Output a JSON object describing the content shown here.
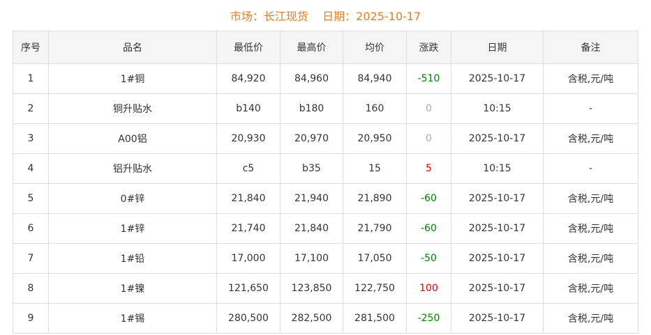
{
  "header": {
    "title": "市场：长江现货    日期：2025-10-17"
  },
  "colors": {
    "title": "#e67e22",
    "down": "#008000",
    "up": "#e00000",
    "flat": "#aaaaaa"
  },
  "table": {
    "columns": [
      "序号",
      "品名",
      "最低价",
      "最高价",
      "均价",
      "涨跌",
      "日期",
      "备注"
    ],
    "rows": [
      {
        "no": "1",
        "name": "1#铜",
        "low": "84,920",
        "high": "84,960",
        "avg": "84,940",
        "change": "-510",
        "change_dir": "down",
        "date": "2025-10-17",
        "note": "含税,元/吨"
      },
      {
        "no": "2",
        "name": "铜升贴水",
        "low": "b140",
        "high": "b180",
        "avg": "160",
        "change": "0",
        "change_dir": "flat",
        "date": "10:15",
        "note": "-"
      },
      {
        "no": "3",
        "name": "A00铝",
        "low": "20,930",
        "high": "20,970",
        "avg": "20,950",
        "change": "0",
        "change_dir": "flat",
        "date": "2025-10-17",
        "note": "含税,元/吨"
      },
      {
        "no": "4",
        "name": "铝升贴水",
        "low": "c5",
        "high": "b35",
        "avg": "15",
        "change": "5",
        "change_dir": "up",
        "date": "10:15",
        "note": "-"
      },
      {
        "no": "5",
        "name": "0#锌",
        "low": "21,840",
        "high": "21,940",
        "avg": "21,890",
        "change": "-60",
        "change_dir": "down",
        "date": "2025-10-17",
        "note": "含税,元/吨"
      },
      {
        "no": "6",
        "name": "1#锌",
        "low": "21,740",
        "high": "21,840",
        "avg": "21,790",
        "change": "-60",
        "change_dir": "down",
        "date": "2025-10-17",
        "note": "含税,元/吨"
      },
      {
        "no": "7",
        "name": "1#铅",
        "low": "17,000",
        "high": "17,100",
        "avg": "17,050",
        "change": "-50",
        "change_dir": "down",
        "date": "2025-10-17",
        "note": "含税,元/吨"
      },
      {
        "no": "8",
        "name": "1#镍",
        "low": "121,650",
        "high": "123,850",
        "avg": "122,750",
        "change": "100",
        "change_dir": "up",
        "date": "2025-10-17",
        "note": "含税,元/吨"
      },
      {
        "no": "9",
        "name": "1#锡",
        "low": "280,500",
        "high": "282,500",
        "avg": "281,500",
        "change": "-250",
        "change_dir": "down",
        "date": "2025-10-17",
        "note": "含税,元/吨"
      }
    ]
  }
}
